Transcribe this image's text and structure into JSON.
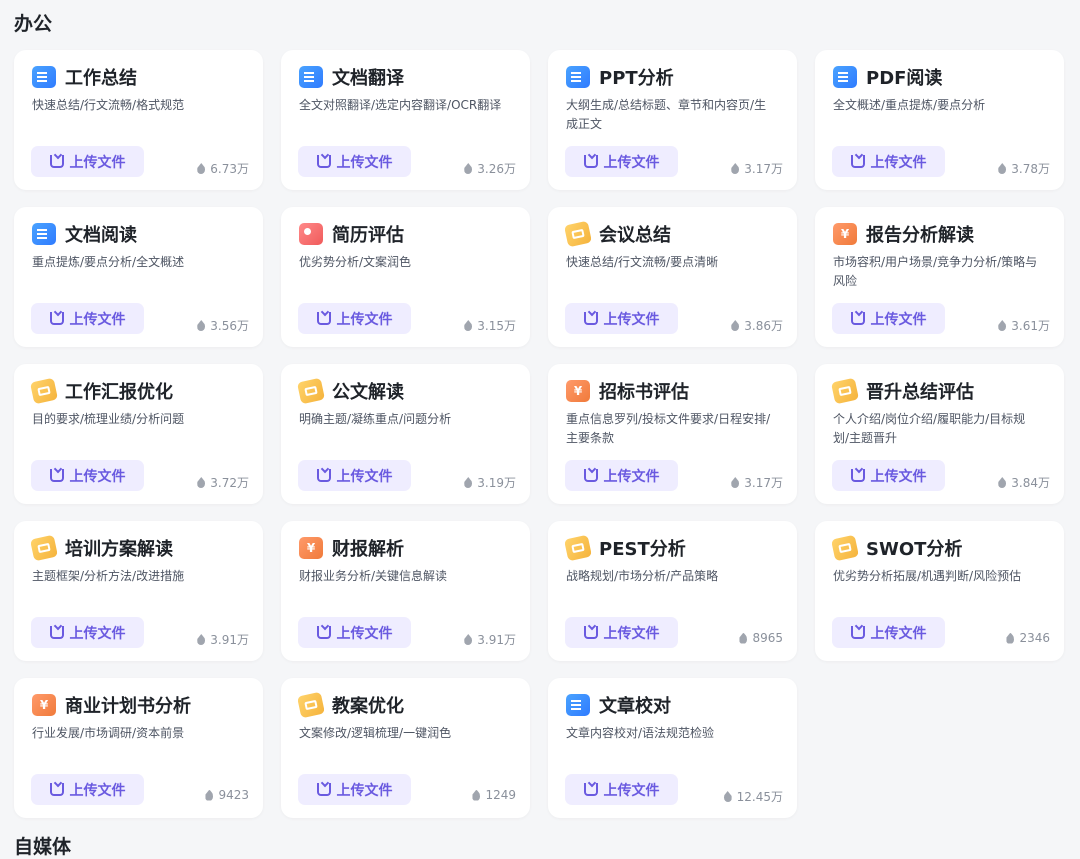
{
  "sections": [
    {
      "title": "办公"
    },
    {
      "title": "自媒体"
    }
  ],
  "upload_label": "上传文件",
  "cards": [
    {
      "title": "工作总结",
      "desc": "快速总结/行文流畅/格式规范",
      "count": "6.73万",
      "icon": "doc"
    },
    {
      "title": "文档翻译",
      "desc": "全文对照翻译/选定内容翻译/OCR翻译",
      "count": "3.26万",
      "icon": "doc"
    },
    {
      "title": "PPT分析",
      "desc": "大纲生成/总结标题、章节和内容页/生成正文",
      "count": "3.17万",
      "icon": "doc"
    },
    {
      "title": "PDF阅读",
      "desc": "全文概述/重点提炼/要点分析",
      "count": "3.78万",
      "icon": "doc"
    },
    {
      "title": "文档阅读",
      "desc": "重点提炼/要点分析/全文概述",
      "count": "3.56万",
      "icon": "doc"
    },
    {
      "title": "简历评估",
      "desc": "优劣势分析/文案润色",
      "count": "3.15万",
      "icon": "resume"
    },
    {
      "title": "会议总结",
      "desc": "快速总结/行文流畅/要点清晰",
      "count": "3.86万",
      "icon": "ticket"
    },
    {
      "title": "报告分析解读",
      "desc": "市场容积/用户场景/竞争力分析/策略与风险",
      "count": "3.61万",
      "icon": "coin"
    },
    {
      "title": "工作汇报优化",
      "desc": "目的要求/梳理业绩/分析问题",
      "count": "3.72万",
      "icon": "ticket"
    },
    {
      "title": "公文解读",
      "desc": "明确主题/凝练重点/问题分析",
      "count": "3.19万",
      "icon": "ticket"
    },
    {
      "title": "招标书评估",
      "desc": "重点信息罗列/投标文件要求/日程安排/主要条款",
      "count": "3.17万",
      "icon": "coin"
    },
    {
      "title": "晋升总结评估",
      "desc": "个人介绍/岗位介绍/履职能力/目标规划/主题晋升",
      "count": "3.84万",
      "icon": "ticket"
    },
    {
      "title": "培训方案解读",
      "desc": "主题框架/分析方法/改进措施",
      "count": "3.91万",
      "icon": "ticket"
    },
    {
      "title": "财报解析",
      "desc": "财报业务分析/关键信息解读",
      "count": "3.91万",
      "icon": "coin"
    },
    {
      "title": "PEST分析",
      "desc": "战略规划/市场分析/产品策略",
      "count": "8965",
      "icon": "ticket"
    },
    {
      "title": "SWOT分析",
      "desc": "优劣势分析拓展/机遇判断/风险预估",
      "count": "2346",
      "icon": "ticket"
    },
    {
      "title": "商业计划书分析",
      "desc": "行业发展/市场调研/资本前景",
      "count": "9423",
      "icon": "coin"
    },
    {
      "title": "教案优化",
      "desc": "文案修改/逻辑梳理/一键润色",
      "count": "1249",
      "icon": "ticket"
    },
    {
      "title": "文章校对",
      "desc": "文章内容校对/语法规范检验",
      "count": "12.45万",
      "icon": "doc"
    }
  ]
}
